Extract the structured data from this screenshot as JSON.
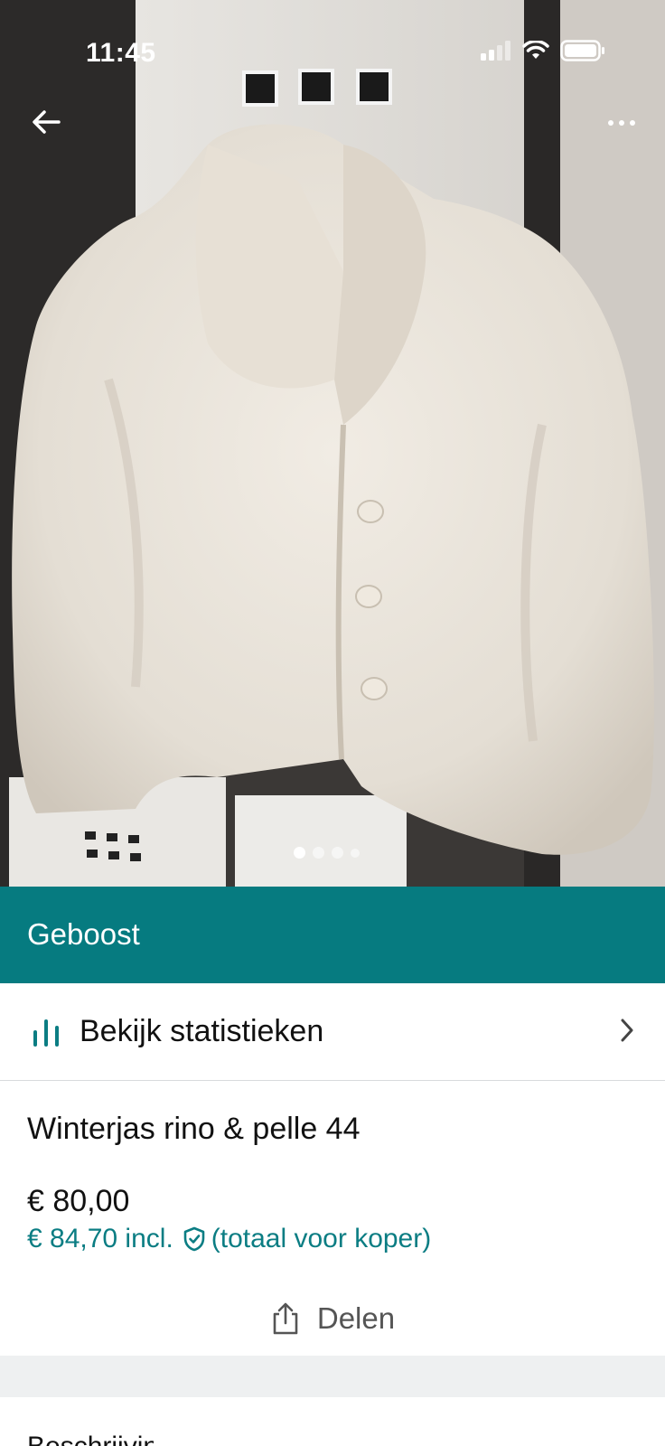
{
  "status_bar": {
    "time": "11:45"
  },
  "photo": {
    "page_indicator": {
      "total": 4,
      "current": 1
    }
  },
  "toolbar": {
    "back_icon": "arrow-left-icon",
    "more_icon": "more-horizontal-icon"
  },
  "boost_banner": {
    "label": "Geboost",
    "color": "#067b80"
  },
  "stats_row": {
    "label": "Bekijk statistieken",
    "icon": "bar-chart-icon",
    "chevron_icon": "chevron-right-icon"
  },
  "item": {
    "title": "Winterjas rino & pelle 44",
    "price": "€ 80,00",
    "price_incl": "€ 84,70 incl.",
    "price_incl_note": "(totaal voor koper)",
    "protection_icon": "shield-check-icon"
  },
  "share": {
    "label": "Delen",
    "icon": "share-icon"
  },
  "next_section": {
    "partial_label": "Beschrijving"
  },
  "colors": {
    "accent": "#0b7d83",
    "banner": "#067b80",
    "divider": "#d8dadc",
    "band": "#eef0f1"
  }
}
